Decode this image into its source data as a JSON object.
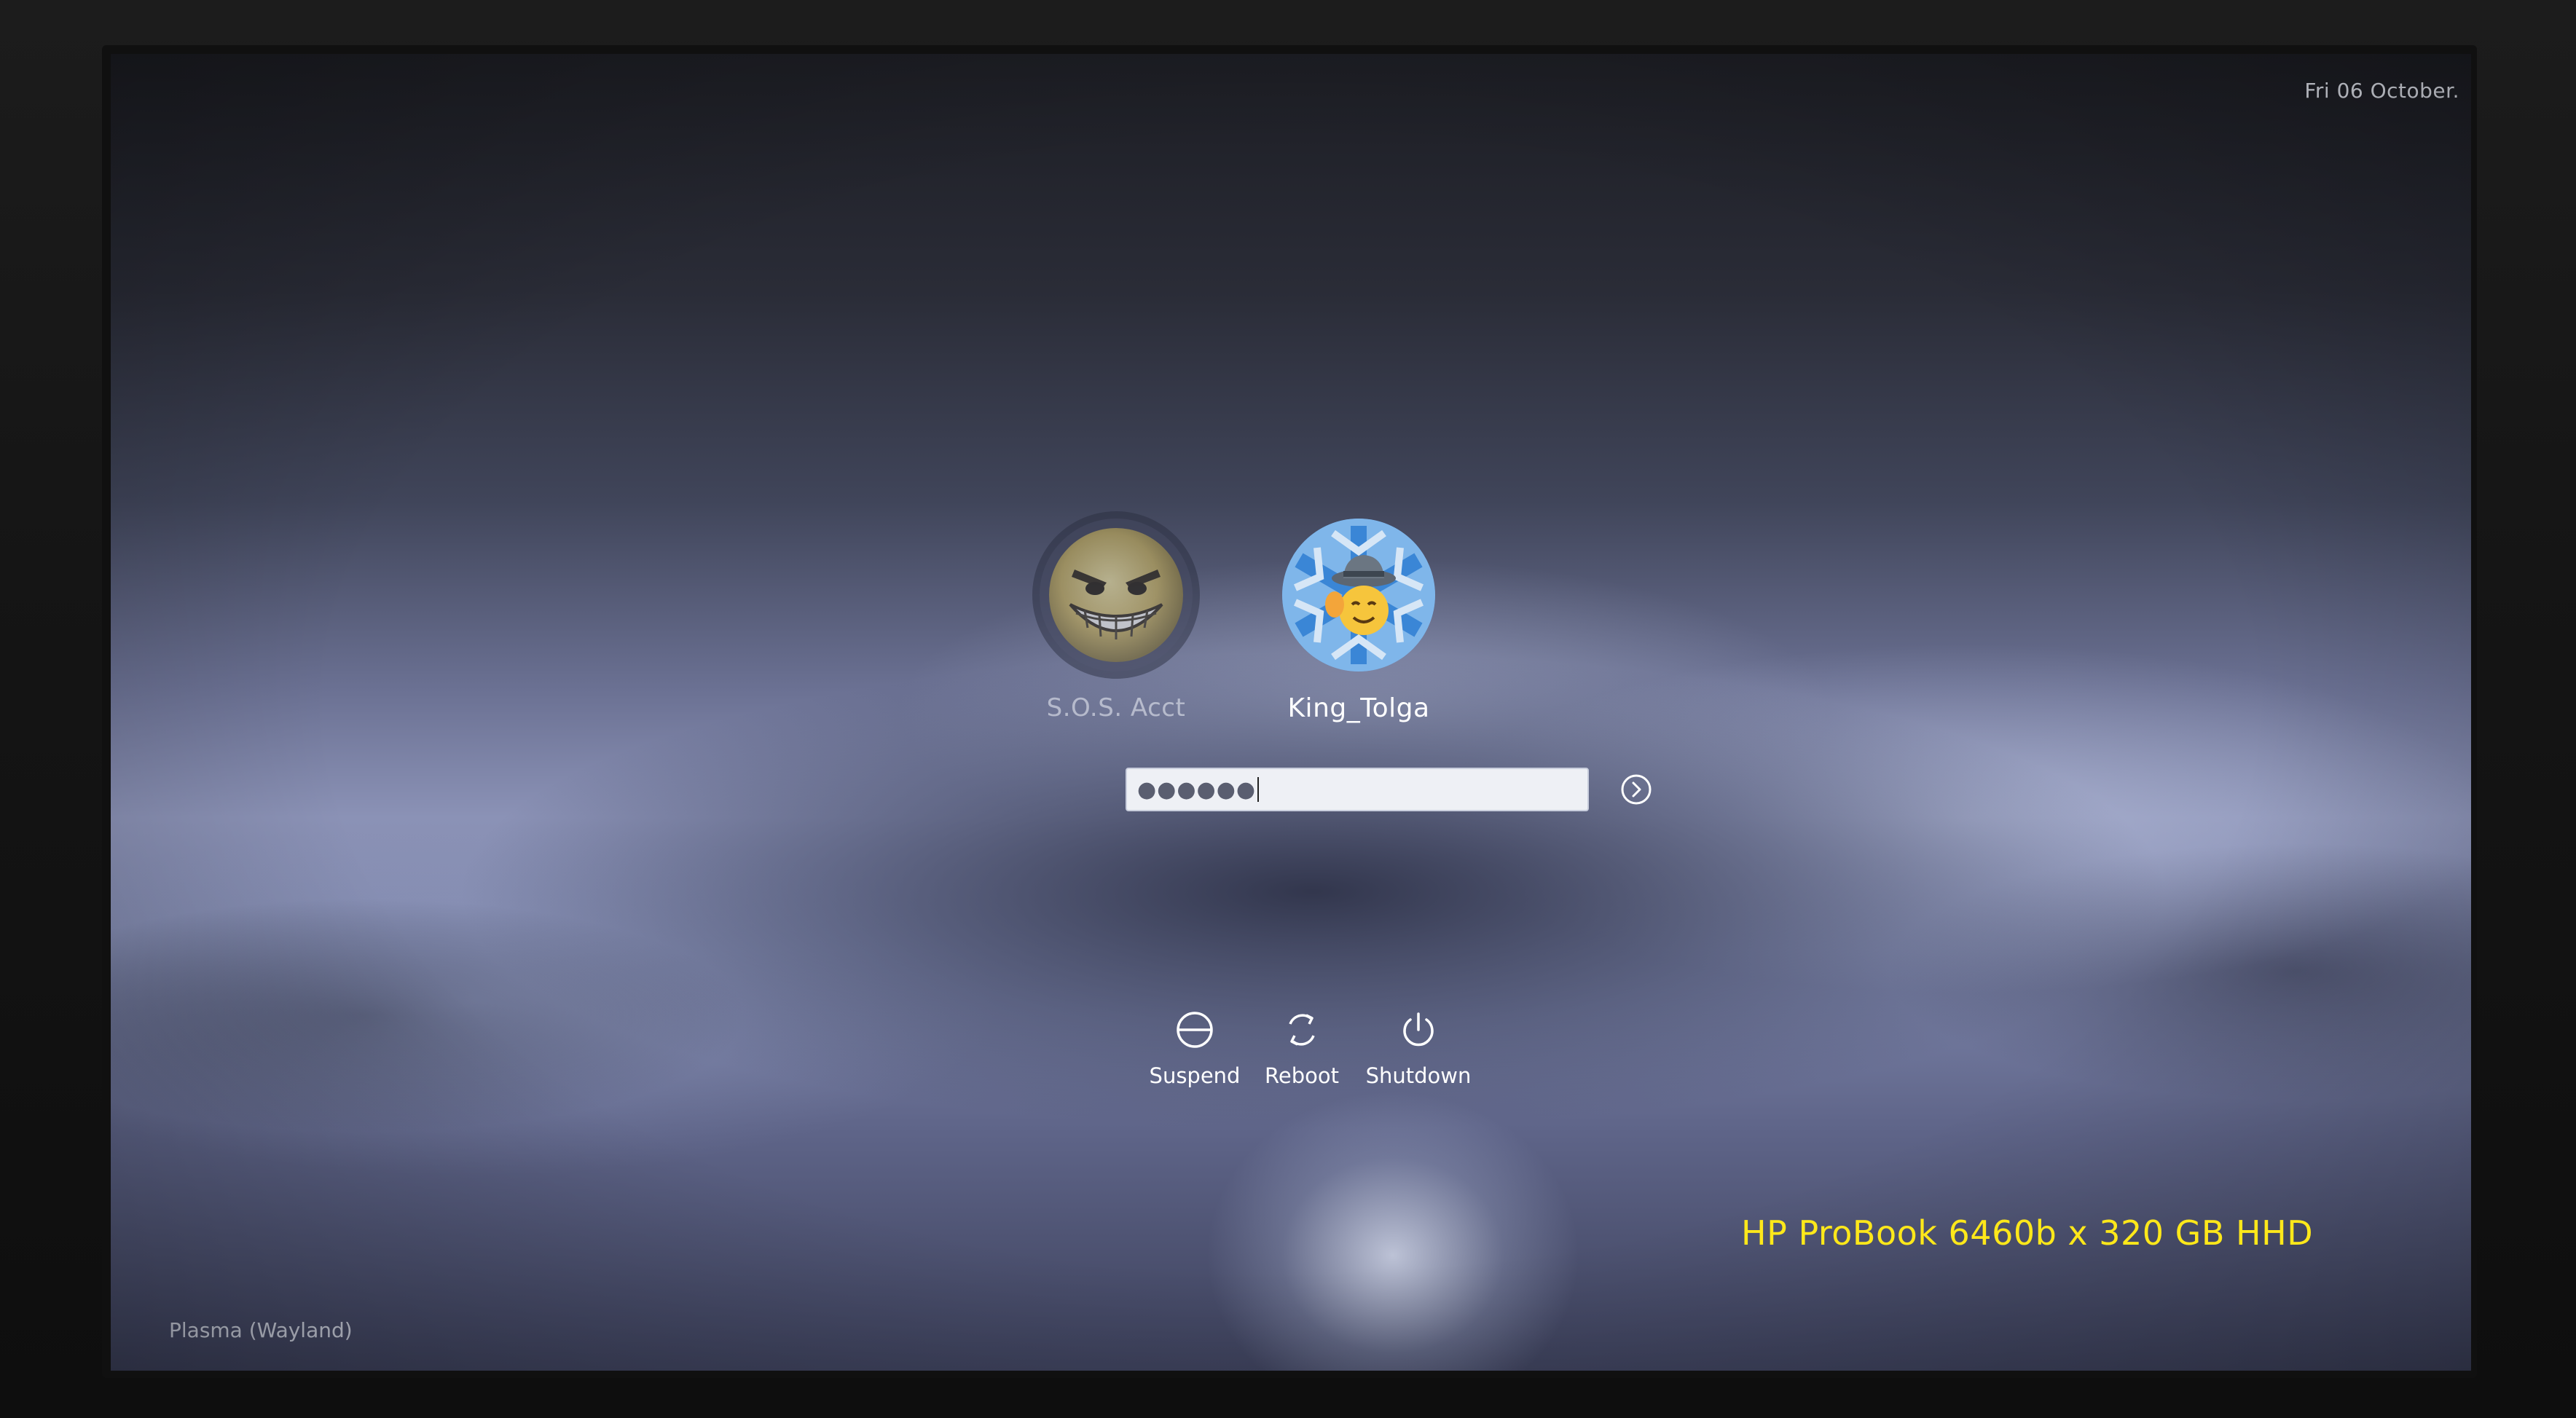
{
  "clock": {
    "text": "Fri 06 October."
  },
  "users": [
    {
      "name": "S.O.S. Acct",
      "selected": false,
      "avatar_icon": "grinning-face-icon"
    },
    {
      "name": "King_Tolga",
      "selected": true,
      "avatar_icon": "snowflake-avatar-icon"
    }
  ],
  "login": {
    "password_masked": "●●●●●●",
    "submit_icon": "arrow-right-circle-icon"
  },
  "power_actions": [
    {
      "label": "Suspend",
      "icon": "suspend-icon"
    },
    {
      "label": "Reboot",
      "icon": "reboot-icon"
    },
    {
      "label": "Shutdown",
      "icon": "power-icon"
    }
  ],
  "session": {
    "label": "Plasma (Wayland)"
  },
  "watermark": {
    "text": "HP ProBook 6460b x 320 GB HHD",
    "color": "#ffe81a"
  }
}
